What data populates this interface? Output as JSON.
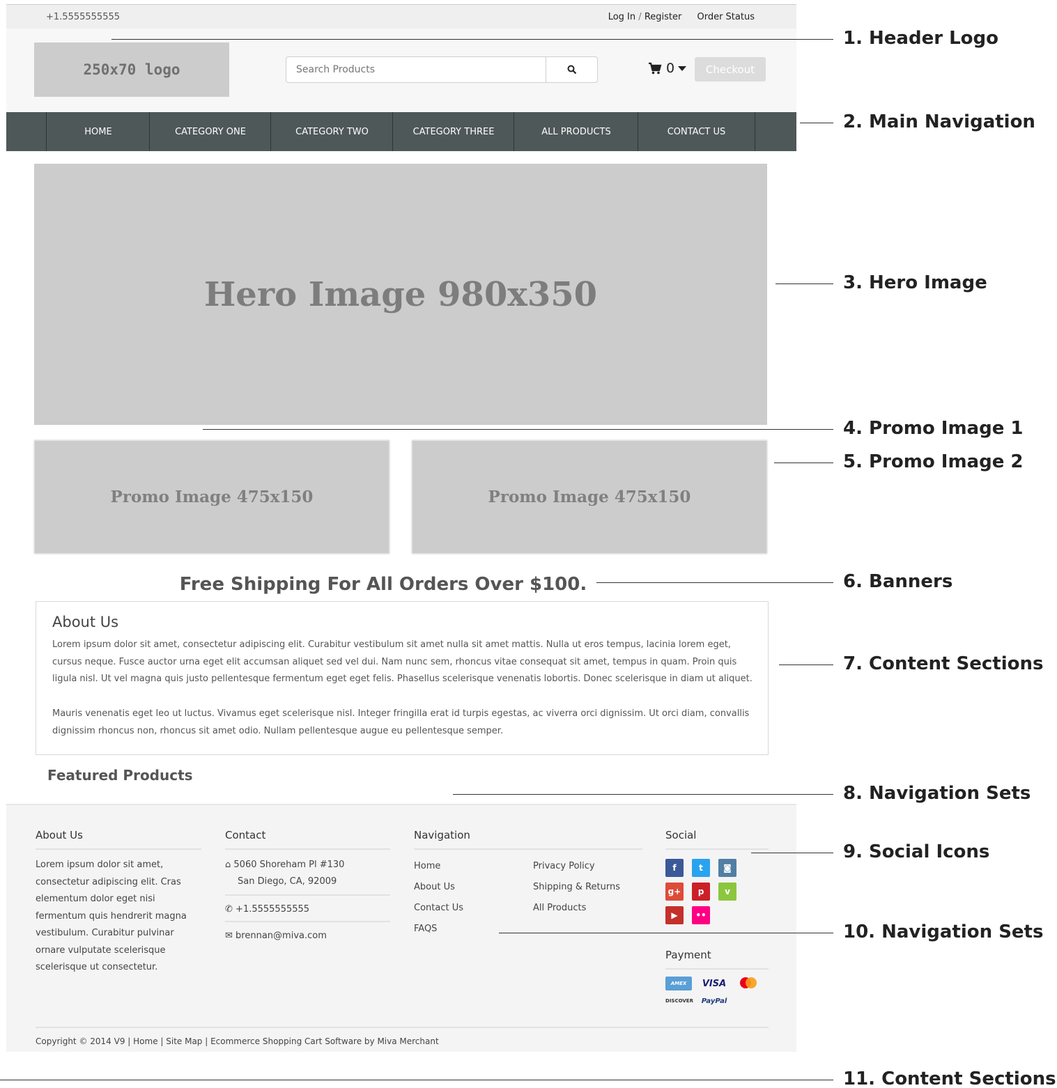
{
  "topbar": {
    "phone": "+1.5555555555",
    "login": "Log In",
    "separator": "/",
    "register": "Register",
    "order_status": "Order Status"
  },
  "header": {
    "logo_text": "250x70 logo",
    "search_placeholder": "Search Products",
    "search_icon": "search-icon",
    "cart_count": "0",
    "checkout_label": "Checkout"
  },
  "nav": {
    "items": [
      "HOME",
      "CATEGORY ONE",
      "CATEGORY TWO",
      "CATEGORY THREE",
      "ALL PRODUCTS",
      "CONTACT US"
    ]
  },
  "hero": {
    "text": "Hero Image 980x350"
  },
  "promos": [
    "Promo Image 475x150",
    "Promo Image 475x150"
  ],
  "banner": "Free Shipping For All Orders Over $100.",
  "about": {
    "title": "About Us",
    "paragraphs": [
      "Lorem ipsum dolor sit amet, consectetur adipiscing elit. Curabitur vestibulum sit amet nulla sit amet mattis. Nulla ut eros tempus, lacinia lorem eget, cursus neque. Fusce auctor urna eget elit accumsan aliquet sed vel dui. Nam nunc sem, rhoncus vitae consequat sit amet, tempus in quam. Proin quis ligula nisl. Ut vel magna quis justo pellentesque fermentum eget eget felis. Phasellus scelerisque venenatis lobortis. Donec scelerisque in diam ut aliquet.",
      "Mauris venenatis eget leo ut luctus. Vivamus eget scelerisque nisl. Integer fringilla erat id turpis egestas, ac viverra orci dignissim. Ut orci diam, convallis dignissim rhoncus non, rhoncus sit amet odio. Nullam pellentesque augue eu pellentesque semper."
    ]
  },
  "featured_title": "Featured Products",
  "footer": {
    "about": {
      "title": "About Us",
      "text": "Lorem ipsum dolor sit amet, consectetur adipiscing elit. Cras elementum dolor eget nisi fermentum quis hendrerit magna vestibulum. Curabitur pulvinar ornare vulputate scelerisque scelerisque ut consectetur."
    },
    "contact": {
      "title": "Contact",
      "address1": "5060 Shoreham Pl #130",
      "address2": "San Diego, CA, 92009",
      "phone": "+1.5555555555",
      "email": "brennan@miva.com"
    },
    "navigation": {
      "title": "Navigation",
      "col1": [
        "Home",
        "About Us",
        "Contact Us",
        "FAQS"
      ],
      "col2": [
        "Privacy Policy",
        "Shipping & Returns",
        "All Products"
      ]
    },
    "social": {
      "title": "Social",
      "icons": [
        {
          "name": "facebook-icon",
          "glyph": "f",
          "color": "#3b5998"
        },
        {
          "name": "twitter-icon",
          "glyph": "t",
          "color": "#2aa3ef"
        },
        {
          "name": "instagram-icon",
          "glyph": "◙",
          "color": "#517fa4"
        },
        {
          "name": "google-plus-icon",
          "glyph": "g+",
          "color": "#dd4b39"
        },
        {
          "name": "pinterest-icon",
          "glyph": "p",
          "color": "#cb2027"
        },
        {
          "name": "vine-icon",
          "glyph": "v",
          "color": "#8cc63f"
        },
        {
          "name": "youtube-icon",
          "glyph": "▶",
          "color": "#c4302b"
        },
        {
          "name": "flickr-icon",
          "glyph": "••",
          "color": "#ff0084"
        }
      ]
    },
    "payment": {
      "title": "Payment",
      "cards": [
        "AMEX",
        "VISA",
        "MC",
        "DISCOVER",
        "PayPal"
      ]
    },
    "copyright": "Copyright © 2014 V9 | Home | Site Map | Ecommerce Shopping Cart Software by Miva Merchant"
  },
  "callouts": [
    "1. Header Logo",
    "2. Main Navigation",
    "3. Hero Image",
    "4. Promo Image 1",
    "5. Promo Image 2",
    "6. Banners",
    "7. Content Sections",
    "8. Navigation Sets",
    "9. Social Icons",
    "10. Navigation Sets",
    "11. Content Sections"
  ]
}
